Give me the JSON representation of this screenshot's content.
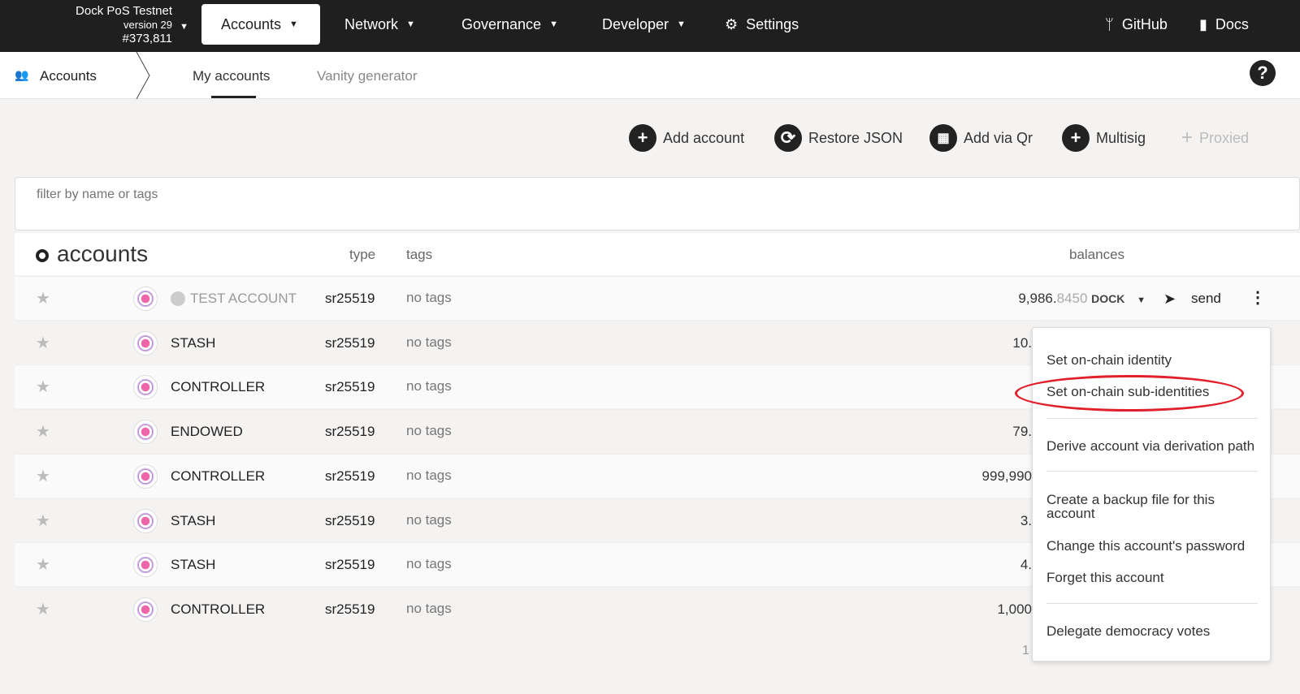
{
  "header": {
    "chain_name": "Dock PoS Testnet",
    "version": "version 29",
    "block": "#373,811",
    "nav": [
      {
        "label": "Accounts"
      },
      {
        "label": "Network"
      },
      {
        "label": "Governance"
      },
      {
        "label": "Developer"
      },
      {
        "label": "Settings"
      }
    ],
    "github": "GitHub",
    "docs": "Docs"
  },
  "subnav": {
    "section": "Accounts",
    "tabs": [
      {
        "label": "My accounts",
        "active": true
      },
      {
        "label": "Vanity generator"
      }
    ],
    "help": "?"
  },
  "actions": {
    "add": "Add account",
    "restore": "Restore JSON",
    "qr": "Add via Qr",
    "multisig": "Multisig",
    "proxied": "Proxied"
  },
  "filter": {
    "placeholder": "filter by name or tags"
  },
  "table": {
    "title": "accounts",
    "type": "type",
    "tags": "tags",
    "balances": "balances",
    "rows": [
      {
        "name": "TEST ACCOUNT",
        "type": "sr25519",
        "tags": "no tags",
        "balance_int": "9,986.",
        "balance_dec": "8450",
        "unit": "DOCK",
        "send": "send"
      },
      {
        "name": "STASH",
        "type": "sr25519",
        "tags": "no tags",
        "balance_int": "10."
      },
      {
        "name": "CONTROLLER",
        "type": "sr25519",
        "tags": "no tags",
        "balance_int": ""
      },
      {
        "name": "ENDOWED",
        "type": "sr25519",
        "tags": "no tags",
        "balance_int": "79."
      },
      {
        "name": "CONTROLLER",
        "type": "sr25519",
        "tags": "no tags",
        "balance_int": "999,990"
      },
      {
        "name": "STASH",
        "type": "sr25519",
        "tags": "no tags",
        "balance_int": "3."
      },
      {
        "name": "STASH",
        "type": "sr25519",
        "tags": "no tags",
        "balance_int": "4."
      },
      {
        "name": "CONTROLLER",
        "type": "sr25519",
        "tags": "no tags",
        "balance_int": "1,000"
      }
    ],
    "footer": "1"
  },
  "menu": {
    "items": [
      "Set on-chain identity",
      "Set on-chain sub-identities",
      "Derive account via derivation path",
      "Create a backup file for this account",
      "Change this account's password",
      "Forget this account",
      "Delegate democracy votes"
    ],
    "highlight_color": "#e0202a"
  }
}
